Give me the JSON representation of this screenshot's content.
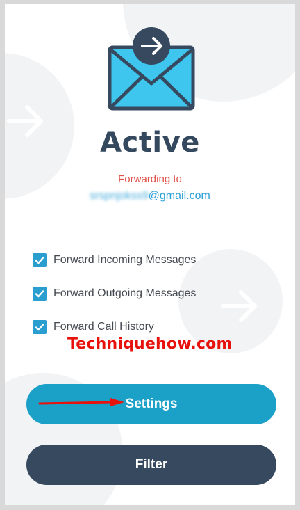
{
  "status": {
    "title": "Active"
  },
  "forwarding": {
    "label": "Forwarding to",
    "email_hidden": "srspnjokss9",
    "email_domain": "@gmail.com"
  },
  "options": [
    {
      "label": "Forward Incoming Messages",
      "checked": true
    },
    {
      "label": "Forward Outgoing Messages",
      "checked": true
    },
    {
      "label": "Forward Call History",
      "checked": true
    }
  ],
  "watermark": "Techniquehow.com",
  "buttons": {
    "settings": "Settings",
    "filter": "Filter"
  },
  "colors": {
    "primary": "#1ba0c8",
    "dark": "#36495e",
    "accent_red": "#e0524a",
    "checkbox": "#2a9fcf",
    "watermark": "#e8120c"
  },
  "icons": [
    "envelope-icon",
    "arrow-right-icon",
    "checkmark-icon",
    "annotation-arrow"
  ]
}
